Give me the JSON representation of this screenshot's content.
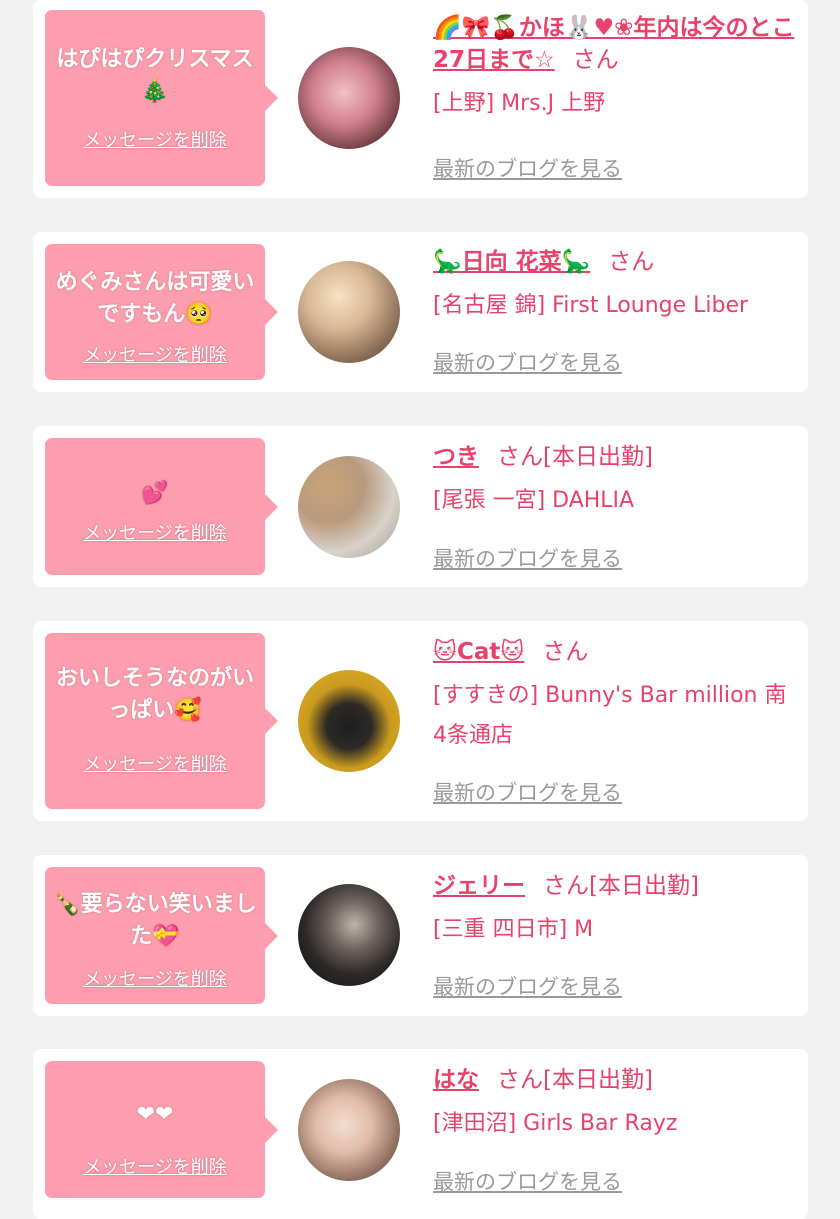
{
  "cards": [
    {
      "message": "はぴはぴクリスマス🎄",
      "delete_label": "メッセージを削除",
      "name": "🌈🎀🍒かほ🐰♥❀年内は今のとこ27日まで☆",
      "suffix": "さん",
      "shop": "[上野] Mrs.J 上野",
      "blog_label": "最新のブログを見る"
    },
    {
      "message": "めぐみさんは可愛いですもん🥺",
      "delete_label": "メッセージを削除",
      "name": "🦕日向 花菜🦕",
      "suffix": "さん",
      "shop": "[名古屋 錦] First Lounge Liber",
      "blog_label": "最新のブログを見る"
    },
    {
      "message": "💕",
      "delete_label": "メッセージを削除",
      "name": "つき",
      "suffix": "さん[本日出勤]",
      "shop": "[尾張 一宮] DAHLIA",
      "blog_label": "最新のブログを見る"
    },
    {
      "message": "おいしそうなのがいっぱい🥰",
      "delete_label": "メッセージを削除",
      "name": "🐱Cat🐱",
      "suffix": "さん",
      "shop": "[すすきの] Bunny's Bar million 南4条通店",
      "blog_label": "最新のブログを見る"
    },
    {
      "message": "🍾要らない笑いました💝",
      "delete_label": "メッセージを削除",
      "name": "ジェリー",
      "suffix": "さん[本日出勤]",
      "shop": "[三重 四日市] M",
      "blog_label": "最新のブログを見る"
    },
    {
      "message": "❤❤",
      "delete_label": "メッセージを削除",
      "name": "はな",
      "suffix": "さん[本日出勤]",
      "shop": "[津田沼] Girls Bar Rayz",
      "blog_label": "最新のブログを見る"
    }
  ],
  "colors": {
    "bubble": "#fd9eae",
    "accent": "#e8416b",
    "muted": "#9a9a9a",
    "background": "#f1f1f1"
  }
}
